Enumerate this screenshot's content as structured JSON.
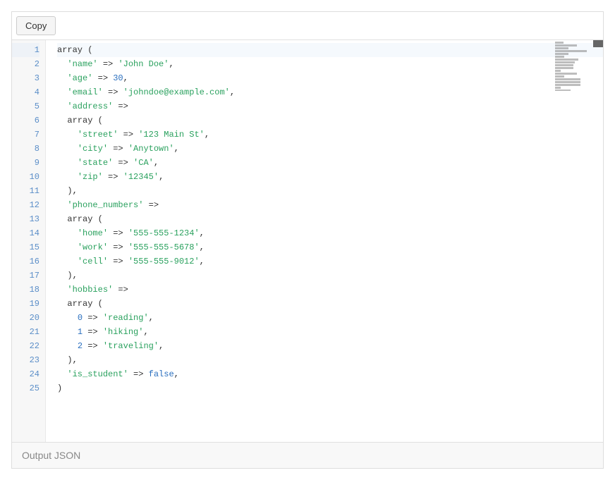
{
  "toolbar": {
    "copy_label": "Copy"
  },
  "footer": {
    "label": "Output JSON"
  },
  "editor": {
    "active_line_index": 0,
    "lines": [
      {
        "num": 1,
        "indent": 0,
        "tokens": [
          {
            "t": "array ",
            "c": "arr"
          },
          {
            "t": "(",
            "c": "paren"
          }
        ]
      },
      {
        "num": 2,
        "indent": 1,
        "tokens": [
          {
            "t": "'name'",
            "c": "green"
          },
          {
            "t": " => ",
            "c": "punct"
          },
          {
            "t": "'John Doe'",
            "c": "green"
          },
          {
            "t": ",",
            "c": "punct"
          }
        ]
      },
      {
        "num": 3,
        "indent": 1,
        "tokens": [
          {
            "t": "'age'",
            "c": "green"
          },
          {
            "t": " => ",
            "c": "punct"
          },
          {
            "t": "30",
            "c": "blue"
          },
          {
            "t": ",",
            "c": "punct"
          }
        ]
      },
      {
        "num": 4,
        "indent": 1,
        "tokens": [
          {
            "t": "'email'",
            "c": "green"
          },
          {
            "t": " => ",
            "c": "punct"
          },
          {
            "t": "'johndoe@example.com'",
            "c": "green"
          },
          {
            "t": ",",
            "c": "punct"
          }
        ]
      },
      {
        "num": 5,
        "indent": 1,
        "tokens": [
          {
            "t": "'address'",
            "c": "green"
          },
          {
            "t": " => ",
            "c": "punct"
          }
        ]
      },
      {
        "num": 6,
        "indent": 1,
        "tokens": [
          {
            "t": "array ",
            "c": "arr"
          },
          {
            "t": "(",
            "c": "paren"
          }
        ]
      },
      {
        "num": 7,
        "indent": 2,
        "tokens": [
          {
            "t": "'street'",
            "c": "green"
          },
          {
            "t": " => ",
            "c": "punct"
          },
          {
            "t": "'123 Main St'",
            "c": "green"
          },
          {
            "t": ",",
            "c": "punct"
          }
        ]
      },
      {
        "num": 8,
        "indent": 2,
        "tokens": [
          {
            "t": "'city'",
            "c": "green"
          },
          {
            "t": " => ",
            "c": "punct"
          },
          {
            "t": "'Anytown'",
            "c": "green"
          },
          {
            "t": ",",
            "c": "punct"
          }
        ]
      },
      {
        "num": 9,
        "indent": 2,
        "tokens": [
          {
            "t": "'state'",
            "c": "green"
          },
          {
            "t": " => ",
            "c": "punct"
          },
          {
            "t": "'CA'",
            "c": "green"
          },
          {
            "t": ",",
            "c": "punct"
          }
        ]
      },
      {
        "num": 10,
        "indent": 2,
        "tokens": [
          {
            "t": "'zip'",
            "c": "green"
          },
          {
            "t": " => ",
            "c": "punct"
          },
          {
            "t": "'12345'",
            "c": "green"
          },
          {
            "t": ",",
            "c": "punct"
          }
        ]
      },
      {
        "num": 11,
        "indent": 1,
        "tokens": [
          {
            "t": ")",
            "c": "paren"
          },
          {
            "t": ",",
            "c": "punct"
          }
        ]
      },
      {
        "num": 12,
        "indent": 1,
        "tokens": [
          {
            "t": "'phone_numbers'",
            "c": "green"
          },
          {
            "t": " => ",
            "c": "punct"
          }
        ]
      },
      {
        "num": 13,
        "indent": 1,
        "tokens": [
          {
            "t": "array ",
            "c": "arr"
          },
          {
            "t": "(",
            "c": "paren"
          }
        ]
      },
      {
        "num": 14,
        "indent": 2,
        "tokens": [
          {
            "t": "'home'",
            "c": "green"
          },
          {
            "t": " => ",
            "c": "punct"
          },
          {
            "t": "'555-555-1234'",
            "c": "green"
          },
          {
            "t": ",",
            "c": "punct"
          }
        ]
      },
      {
        "num": 15,
        "indent": 2,
        "tokens": [
          {
            "t": "'work'",
            "c": "green"
          },
          {
            "t": " => ",
            "c": "punct"
          },
          {
            "t": "'555-555-5678'",
            "c": "green"
          },
          {
            "t": ",",
            "c": "punct"
          }
        ]
      },
      {
        "num": 16,
        "indent": 2,
        "tokens": [
          {
            "t": "'cell'",
            "c": "green"
          },
          {
            "t": " => ",
            "c": "punct"
          },
          {
            "t": "'555-555-9012'",
            "c": "green"
          },
          {
            "t": ",",
            "c": "punct"
          }
        ]
      },
      {
        "num": 17,
        "indent": 1,
        "tokens": [
          {
            "t": ")",
            "c": "paren"
          },
          {
            "t": ",",
            "c": "punct"
          }
        ]
      },
      {
        "num": 18,
        "indent": 1,
        "tokens": [
          {
            "t": "'hobbies'",
            "c": "green"
          },
          {
            "t": " => ",
            "c": "punct"
          }
        ]
      },
      {
        "num": 19,
        "indent": 1,
        "tokens": [
          {
            "t": "array ",
            "c": "arr"
          },
          {
            "t": "(",
            "c": "paren"
          }
        ]
      },
      {
        "num": 20,
        "indent": 2,
        "tokens": [
          {
            "t": "0",
            "c": "blue"
          },
          {
            "t": " => ",
            "c": "punct"
          },
          {
            "t": "'reading'",
            "c": "green"
          },
          {
            "t": ",",
            "c": "punct"
          }
        ]
      },
      {
        "num": 21,
        "indent": 2,
        "tokens": [
          {
            "t": "1",
            "c": "blue"
          },
          {
            "t": " => ",
            "c": "punct"
          },
          {
            "t": "'hiking'",
            "c": "green"
          },
          {
            "t": ",",
            "c": "punct"
          }
        ]
      },
      {
        "num": 22,
        "indent": 2,
        "tokens": [
          {
            "t": "2",
            "c": "blue"
          },
          {
            "t": " => ",
            "c": "punct"
          },
          {
            "t": "'traveling'",
            "c": "green"
          },
          {
            "t": ",",
            "c": "punct"
          }
        ]
      },
      {
        "num": 23,
        "indent": 1,
        "tokens": [
          {
            "t": ")",
            "c": "paren"
          },
          {
            "t": ",",
            "c": "punct"
          }
        ]
      },
      {
        "num": 24,
        "indent": 1,
        "tokens": [
          {
            "t": "'is_student'",
            "c": "green"
          },
          {
            "t": " => ",
            "c": "punct"
          },
          {
            "t": "false",
            "c": "blue"
          },
          {
            "t": ",",
            "c": "punct"
          }
        ]
      },
      {
        "num": 25,
        "indent": 0,
        "tokens": [
          {
            "t": ")",
            "c": "paren"
          }
        ]
      }
    ]
  },
  "minimap": {
    "line_widths_pct": [
      18,
      48,
      30,
      70,
      30,
      20,
      52,
      44,
      40,
      40,
      12,
      48,
      20,
      56,
      56,
      56,
      12,
      34,
      20,
      42,
      40,
      46,
      12,
      52,
      8
    ]
  }
}
